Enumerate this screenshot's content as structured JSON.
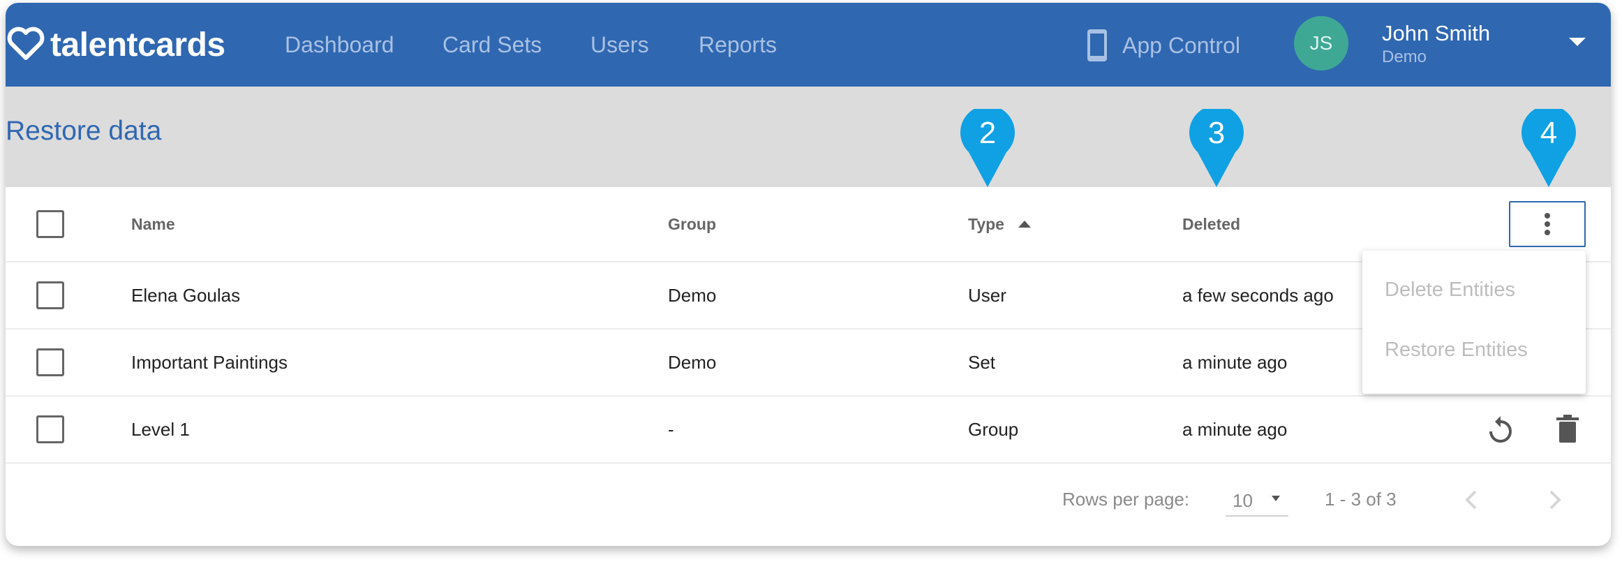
{
  "header": {
    "logo_text": "talentcards",
    "nav": [
      {
        "label": "Dashboard"
      },
      {
        "label": "Card Sets"
      },
      {
        "label": "Users"
      },
      {
        "label": "Reports"
      }
    ],
    "app_control_label": "App Control",
    "user": {
      "initials": "JS",
      "name": "John Smith",
      "subtitle": "Demo"
    }
  },
  "page": {
    "title": "Restore data"
  },
  "table": {
    "columns": {
      "name": "Name",
      "group": "Group",
      "type": "Type",
      "deleted": "Deleted"
    },
    "sort": {
      "column": "Type",
      "direction": "ascending"
    },
    "rows": [
      {
        "name": "Elena Goulas",
        "group": "Demo",
        "type": "User",
        "deleted": "a few seconds ago"
      },
      {
        "name": "Important Paintings",
        "group": "Demo",
        "type": "Set",
        "deleted": "a minute ago"
      },
      {
        "name": "Level 1",
        "group": "-",
        "type": "Group",
        "deleted": "a minute ago"
      }
    ]
  },
  "bulk_menu": {
    "items": [
      {
        "label": "Delete Entities"
      },
      {
        "label": "Restore Entities"
      }
    ]
  },
  "row_actions": {
    "icons": [
      "restore-icon",
      "trash-icon"
    ]
  },
  "footer": {
    "rows_per_page_label": "Rows per page:",
    "rows_per_page_value": "10",
    "range_text": "1 - 3 of 3"
  },
  "callouts": [
    {
      "number": "2"
    },
    {
      "number": "3"
    },
    {
      "number": "4"
    }
  ],
  "colors": {
    "brand_blue": "#2f67b1",
    "avatar_green": "#3ea895",
    "callout_blue": "#0fa1e4",
    "header_gray": "#dcdcdc"
  }
}
